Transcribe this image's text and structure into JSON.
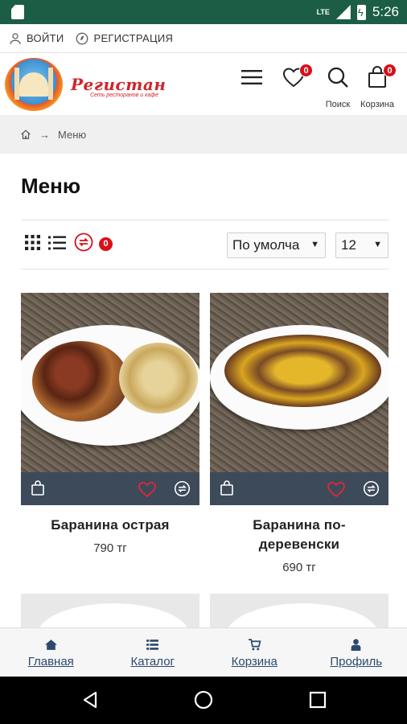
{
  "status_bar": {
    "network": "LTE",
    "time": "5:26"
  },
  "account_bar": {
    "login_label": "ВОЙТИ",
    "register_label": "РЕГИСТРАЦИЯ"
  },
  "header": {
    "brand_name": "Регистан",
    "brand_tagline": "Сеть ресторанов и кафе",
    "wishlist_count": "0",
    "search_label": "Поиск",
    "cart_label": "Корзина",
    "cart_count": "0"
  },
  "breadcrumb": {
    "current": "Меню"
  },
  "page_title": "Меню",
  "toolbar": {
    "compare_count": "0",
    "sort_value": "По умолча",
    "per_page_value": "12"
  },
  "products": [
    {
      "name": "Баранина острая",
      "price": "790 тг"
    },
    {
      "name": "Баранина по-деревенски",
      "price": "690 тг"
    }
  ],
  "bottom_nav": {
    "home": "Главная",
    "catalog": "Каталог",
    "cart": "Корзина",
    "profile": "Профиль"
  },
  "colors": {
    "status_bar": "#1b5e45",
    "brand_red": "#d0242b",
    "card_bar": "#3d4a5a",
    "badge": "#d8101a",
    "nav_link": "#2c4a6e"
  }
}
